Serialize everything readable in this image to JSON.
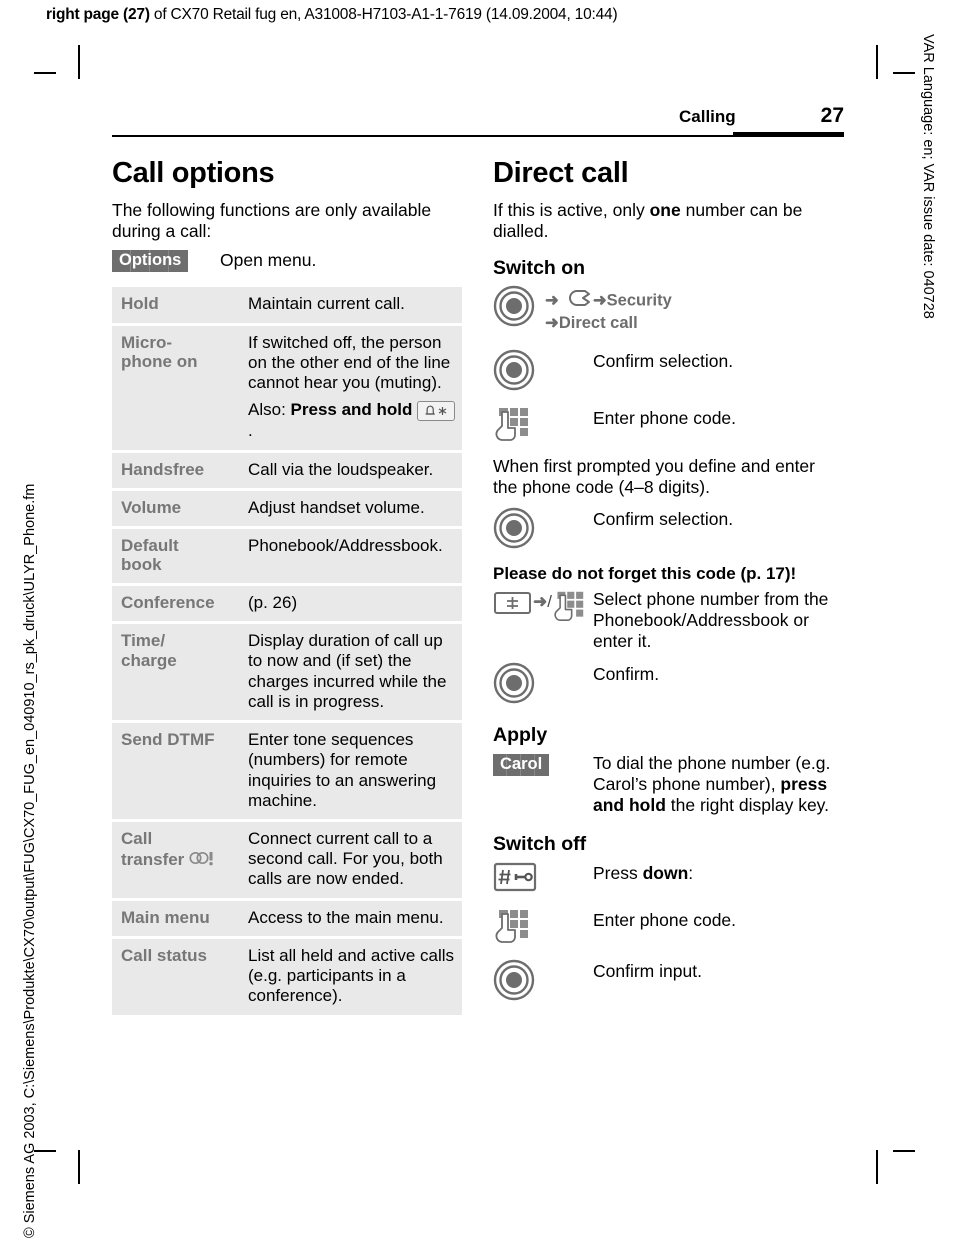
{
  "running_head": {
    "bold": "right page (27)",
    "rest": " of CX70 Retail fug en, A31008-H7103-A1-1-7619 (14.09.2004, 10:44)"
  },
  "side_text": {
    "left": "© Siemens AG 2003, C:\\Siemens\\Produkte\\CX70\\output\\FUG\\CX70_FUG_en_040910_rs_pk_druck\\ULYR_Phone.fm",
    "right": "VAR Language: en; VAR issue date: 040728"
  },
  "page_header": {
    "chapter": "Calling",
    "page_number": "27"
  },
  "left_column": {
    "title": "Call options",
    "intro": "The following functions are only available during a call:",
    "softkey": {
      "label": "Options",
      "description": "Open menu."
    },
    "table": {
      "rows": [
        {
          "key": "Hold",
          "value": "Maintain current call."
        },
        {
          "key": "Micro-\nphone on",
          "value": "If switched off, the person on the other end of the line cannot hear you (muting).",
          "value2_prefix": "Also: ",
          "value2_bold": "Press and hold",
          "value2_suffix": ".",
          "value2_icon": "bell-asterisk-key-icon"
        },
        {
          "key": "Handsfree",
          "value": "Call via the loudspeaker."
        },
        {
          "key": "Volume",
          "value": "Adjust handset volume."
        },
        {
          "key": "Default\nbook",
          "value": "Phonebook/Addressbook."
        },
        {
          "key": "Conference",
          "value": "(p. 26)"
        },
        {
          "key": "Time/\ncharge",
          "value": "Display duration of call up to now and (if set) the charges incurred while the call is in progress."
        },
        {
          "key": "Send DTMF",
          "value": "Enter tone sequences (numbers) for remote inquiries to an answering machine."
        },
        {
          "key": "Call\ntransfer",
          "key_icon": "network-dependent-icon",
          "value": "Connect current call to a second call. For you, both calls are now ended."
        },
        {
          "key": "Main menu",
          "value": "Access to the main menu."
        },
        {
          "key": "Call status",
          "value": "List all held and active calls (e.g. participants in a conference)."
        }
      ]
    }
  },
  "right_column": {
    "title": "Direct call",
    "intro_pre": "If this is active, only ",
    "intro_bold": "one",
    "intro_post": " number can be dialled.",
    "switch_on": {
      "heading": "Switch on",
      "menu_path": {
        "icon": "navigation-key-icon",
        "arrow": "➜",
        "settings_icon": "spanner-settings-icon",
        "item1": "Security",
        "item2": "Direct call"
      },
      "steps": [
        {
          "icon": "navigation-key-icon",
          "text": "Confirm selection."
        },
        {
          "icon": "keypad-hand-icon",
          "text": "Enter phone code."
        }
      ],
      "note": "When first prompted you define and enter the phone code (4–8 digits).",
      "confirm": {
        "icon": "navigation-key-icon",
        "text": "Confirm selection."
      },
      "warning": "Please do not forget this code (p. 17)!",
      "select_step": {
        "icon1": "plusminus-key-icon",
        "arrow": "➜",
        "slash": "/",
        "icon2": "keypad-hand-icon",
        "text": "Select phone number from the Phonebook/Addressbook or enter it."
      },
      "final_confirm": {
        "icon": "navigation-key-icon",
        "text": "Confirm."
      }
    },
    "apply": {
      "heading": "Apply",
      "softkey_label": "Carol",
      "text_pre": "To dial the phone number (e.g. Carol’s phone number), ",
      "text_bold": "press and hold",
      "text_post": " the right display key."
    },
    "switch_off": {
      "heading": "Switch off",
      "steps": [
        {
          "icon": "hash-key-lock-icon",
          "text_pre": "Press ",
          "text_bold": "down",
          "text_post": ":"
        },
        {
          "icon": "keypad-hand-icon",
          "text": "Enter phone code."
        },
        {
          "icon": "navigation-key-icon",
          "text": "Confirm input."
        }
      ]
    }
  },
  "colors": {
    "row_bg": "#e9e9e9",
    "key_text": "#777777",
    "softkey_bg": "#6e6e6e",
    "icon_gray": "#6d6d6d"
  }
}
